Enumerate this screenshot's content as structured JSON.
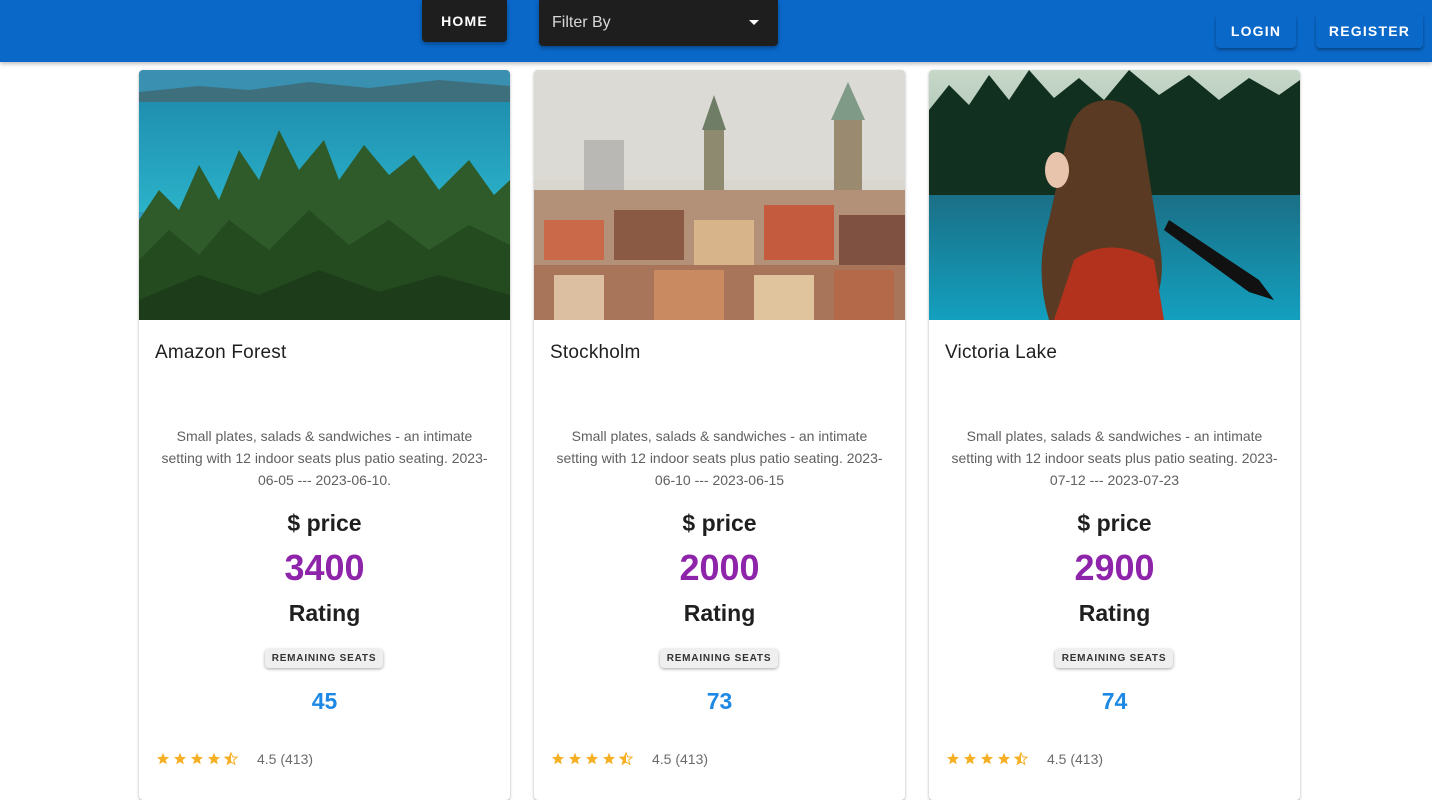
{
  "appbar": {
    "home_label": "HOME",
    "filter_label": "Filter By",
    "login_label": "LOGIN",
    "register_label": "REGISTER",
    "background": "#0a68c9"
  },
  "colors": {
    "price": "#8e24aa",
    "seats": "#1e88e5",
    "star": "#f6b026"
  },
  "cards": [
    {
      "title": "Amazon Forest",
      "image": "forest-lake-photo",
      "description": "Small plates, salads & sandwiches - an intimate setting with 12 indoor seats plus patio seating. 2023-06-05 --- 2023-06-10.",
      "price_label": "$ price",
      "price": "3400",
      "rating_label": "Rating",
      "seats_label": "REMAINING SEATS",
      "seats": "45",
      "stars": 4.5,
      "rating_text": "4.5 (413)"
    },
    {
      "title": "Stockholm",
      "image": "city-skyline-photo",
      "description": "Small plates, salads & sandwiches - an intimate setting with 12 indoor seats plus patio seating. 2023-06-10 --- 2023-06-15",
      "price_label": "$ price",
      "price": "2000",
      "rating_label": "Rating",
      "seats_label": "REMAINING SEATS",
      "seats": "73",
      "stars": 4.5,
      "rating_text": "4.5 (413)"
    },
    {
      "title": "Victoria Lake",
      "image": "woman-canoe-photo",
      "description": "Small plates, salads & sandwiches - an intimate setting with 12 indoor seats plus patio seating. 2023-07-12 --- 2023-07-23",
      "price_label": "$ price",
      "price": "2900",
      "rating_label": "Rating",
      "seats_label": "REMAINING SEATS",
      "seats": "74",
      "stars": 4.5,
      "rating_text": "4.5 (413)"
    }
  ]
}
